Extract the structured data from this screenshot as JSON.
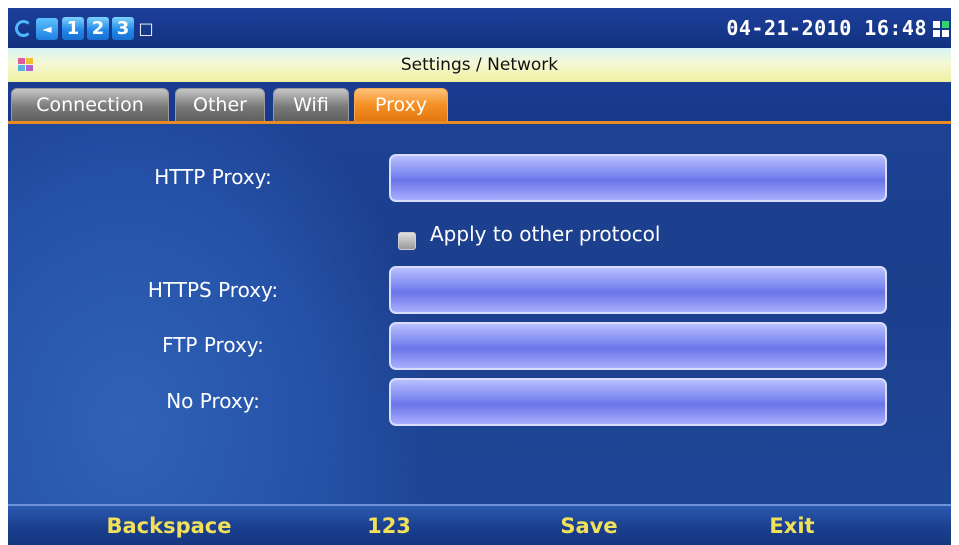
{
  "status_bar": {
    "line_numbers": [
      "1",
      "2",
      "3"
    ],
    "datetime": "04-21-2010 16:48"
  },
  "title_bar": {
    "title": "Settings / Network"
  },
  "tabs": [
    {
      "label": "Connection"
    },
    {
      "label": "Other"
    },
    {
      "label": "Wifi"
    },
    {
      "label": "Proxy"
    }
  ],
  "active_tab": "Proxy",
  "form": {
    "http_proxy": {
      "label": "HTTP Proxy:",
      "value": ""
    },
    "apply_to_other": {
      "label": "Apply to other protocol",
      "checked": false
    },
    "https_proxy": {
      "label": "HTTPS Proxy:",
      "value": ""
    },
    "ftp_proxy": {
      "label": "FTP Proxy:",
      "value": ""
    },
    "no_proxy": {
      "label": "No Proxy:",
      "value": ""
    }
  },
  "softkeys": {
    "backspace": "Backspace",
    "input_mode": "123",
    "save": "Save",
    "exit": "Exit"
  },
  "colors": {
    "active_tab": "#f39124",
    "softkey_text": "#f1e05a",
    "background": "#1d3f8a"
  }
}
